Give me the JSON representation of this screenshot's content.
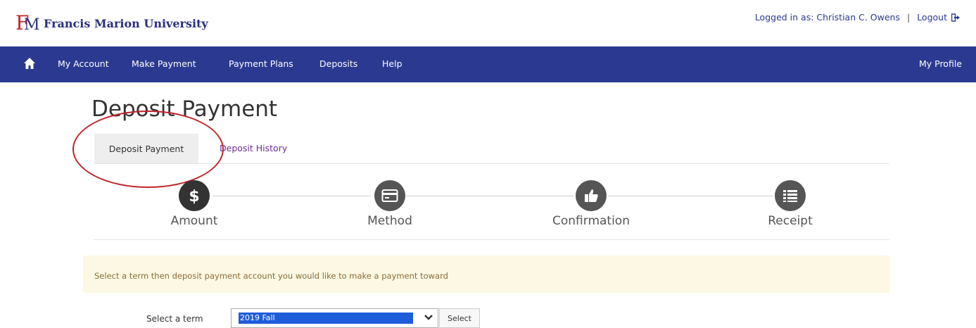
{
  "header": {
    "university_name": "Francis Marion University",
    "logged_in_text": "Logged in as: Christian C. Owens",
    "separator": "|",
    "logout_label": "Logout"
  },
  "nav": {
    "items": [
      "My Account",
      "Make Payment",
      "Payment Plans",
      "Deposits",
      "Help"
    ],
    "right_label": "My Profile",
    "background_color": "#2b3990"
  },
  "page": {
    "title": "Deposit Payment"
  },
  "tabs": {
    "active_label": "Deposit Payment",
    "other_label": "Deposit History"
  },
  "stepper": {
    "steps": [
      {
        "label": "Amount",
        "icon": "dollar-icon",
        "active": true
      },
      {
        "label": "Method",
        "icon": "credit-card-icon",
        "active": false
      },
      {
        "label": "Confirmation",
        "icon": "thumbs-up-icon",
        "active": false
      },
      {
        "label": "Receipt",
        "icon": "list-icon",
        "active": false
      }
    ]
  },
  "alert": {
    "text": "Select a term then deposit payment account you would like to make a payment toward"
  },
  "term": {
    "label": "Select a term",
    "selected_value": "2019 Fall",
    "button_label": "Select"
  },
  "annotation_color": "#c0242b"
}
